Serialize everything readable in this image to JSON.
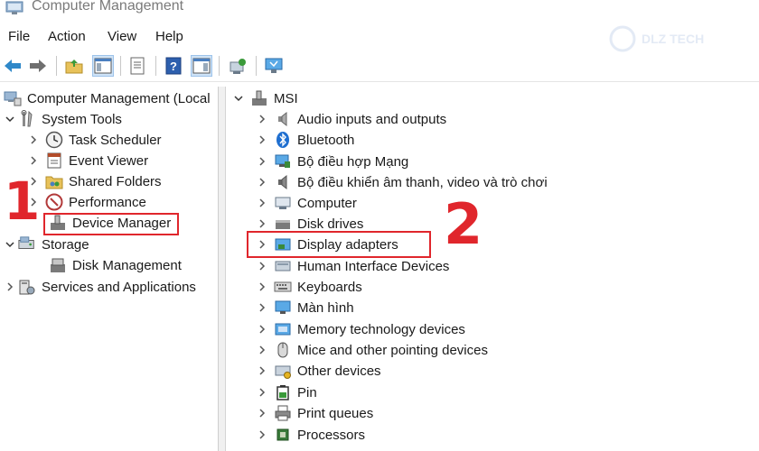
{
  "window": {
    "title": "Computer Management"
  },
  "watermark": {
    "text": "DLZ TECH"
  },
  "menu": [
    {
      "label": "File"
    },
    {
      "label": "Action"
    },
    {
      "label": "View"
    },
    {
      "label": "Help"
    }
  ],
  "left_tree": [
    {
      "label": "Computer Management (Local",
      "chevron": "none",
      "icon": "computer-management-icon"
    },
    {
      "label": "System Tools",
      "chevron": "down",
      "icon": "system-tools-icon"
    },
    {
      "label": "Task Scheduler",
      "chevron": "right",
      "icon": "clock-icon"
    },
    {
      "label": "Event Viewer",
      "chevron": "right",
      "icon": "event-viewer-icon"
    },
    {
      "label": "Shared Folders",
      "chevron": "right",
      "icon": "shared-folder-icon"
    },
    {
      "label": "Performance",
      "chevron": "right",
      "icon": "performance-icon"
    },
    {
      "label": "Device Manager",
      "chevron": "none",
      "icon": "device-manager-icon",
      "highlighted": true
    },
    {
      "label": "Storage",
      "chevron": "down",
      "icon": "storage-icon"
    },
    {
      "label": "Disk Management",
      "chevron": "none",
      "icon": "disk-management-icon"
    },
    {
      "label": "Services and Applications",
      "chevron": "right",
      "icon": "services-icon"
    }
  ],
  "right_tree": {
    "root": {
      "label": "MSI",
      "chevron": "down",
      "icon": "computer-root-icon"
    },
    "items": [
      {
        "label": "Audio inputs and outputs",
        "icon": "speaker-icon"
      },
      {
        "label": "Bluetooth",
        "icon": "bluetooth-icon"
      },
      {
        "label": "Bộ điều hợp Mạng",
        "icon": "network-adapter-icon"
      },
      {
        "label": "Bộ điều khiển âm thanh, video và trò chơi",
        "icon": "sound-controller-icon"
      },
      {
        "label": "Computer",
        "icon": "computer-icon"
      },
      {
        "label": "Disk drives",
        "icon": "disk-drive-icon"
      },
      {
        "label": "Display adapters",
        "icon": "display-adapter-icon",
        "highlighted": true
      },
      {
        "label": "Human Interface Devices",
        "icon": "hid-icon"
      },
      {
        "label": "Keyboards",
        "icon": "keyboard-icon"
      },
      {
        "label": "Màn hình",
        "icon": "monitor-icon"
      },
      {
        "label": "Memory technology devices",
        "icon": "memory-icon"
      },
      {
        "label": "Mice and other pointing devices",
        "icon": "mouse-icon"
      },
      {
        "label": "Other devices",
        "icon": "other-devices-icon"
      },
      {
        "label": "Pin",
        "icon": "battery-icon"
      },
      {
        "label": "Print queues",
        "icon": "printer-icon"
      },
      {
        "label": "Processors",
        "icon": "processor-icon"
      }
    ]
  },
  "annotations": {
    "step1": "1",
    "step2": "2"
  },
  "colors": {
    "annotation_red": "#e0262c",
    "selection": "#cfe3f7"
  }
}
